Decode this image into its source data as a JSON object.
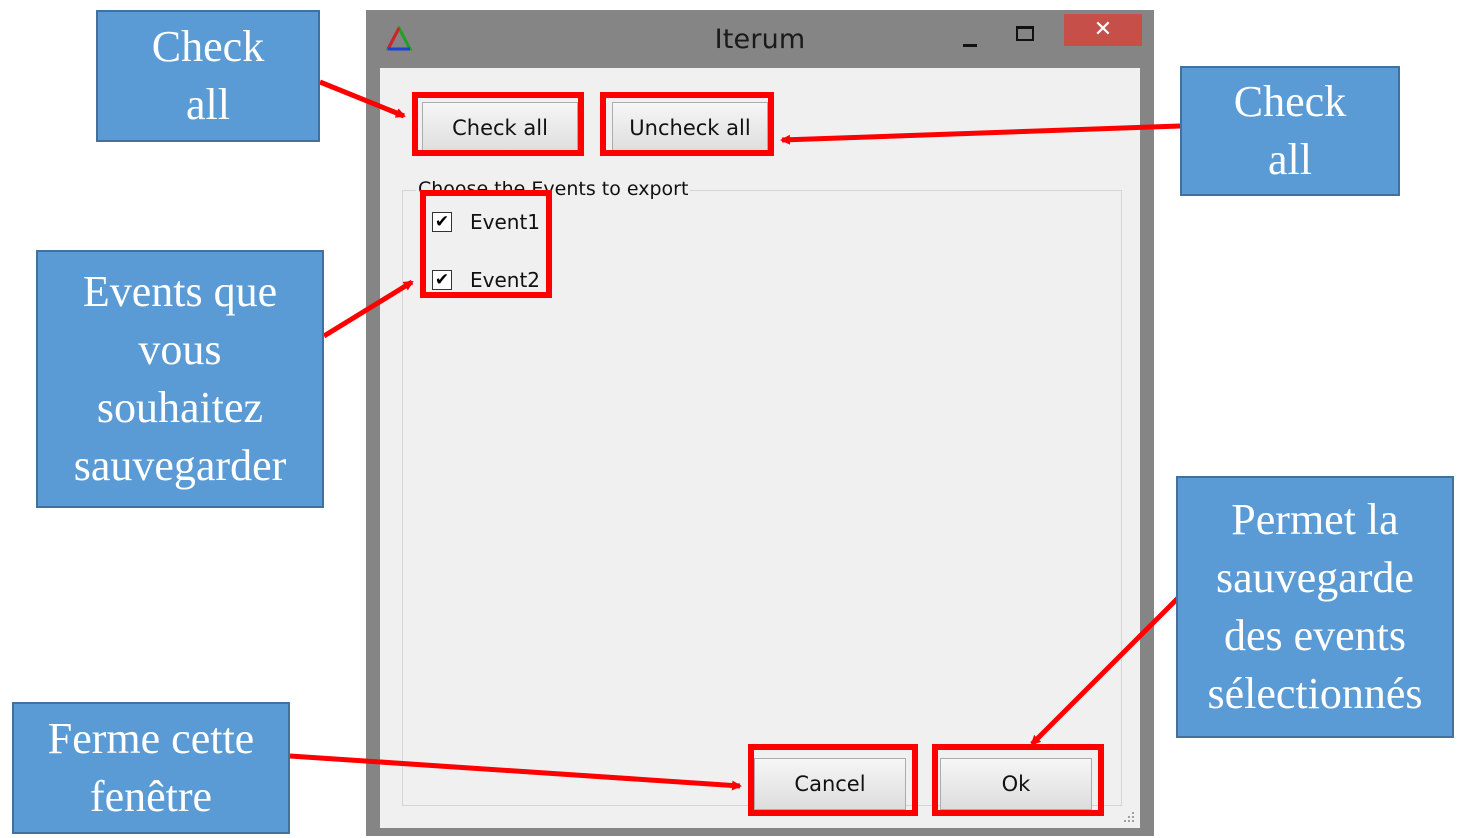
{
  "window": {
    "title": "Iterum",
    "close_glyph": "✕",
    "app_icon": "triangle-logo-icon"
  },
  "dialog": {
    "check_all_label": "Check all",
    "uncheck_all_label": "Uncheck all",
    "group_label": "Choose the Events to export",
    "events": [
      {
        "label": "Event1",
        "checked": true
      },
      {
        "label": "Event2",
        "checked": true
      }
    ],
    "check_glyph": "✔",
    "cancel_label": "Cancel",
    "ok_label": "Ok"
  },
  "annotations": {
    "check_all_left": [
      "Check",
      "all"
    ],
    "check_all_right": [
      "Check",
      "all"
    ],
    "events": [
      "Events que",
      "vous",
      "souhaitez",
      "sauvegarder"
    ],
    "ok": [
      "Permet la",
      "sauvegarde",
      "des events",
      "sélectionnés"
    ],
    "cancel": [
      "Ferme cette",
      "fenêtre"
    ]
  },
  "colors": {
    "callout_fill": "#5b9bd5",
    "highlight": "#ff0000",
    "close_button": "#c74f4a"
  }
}
